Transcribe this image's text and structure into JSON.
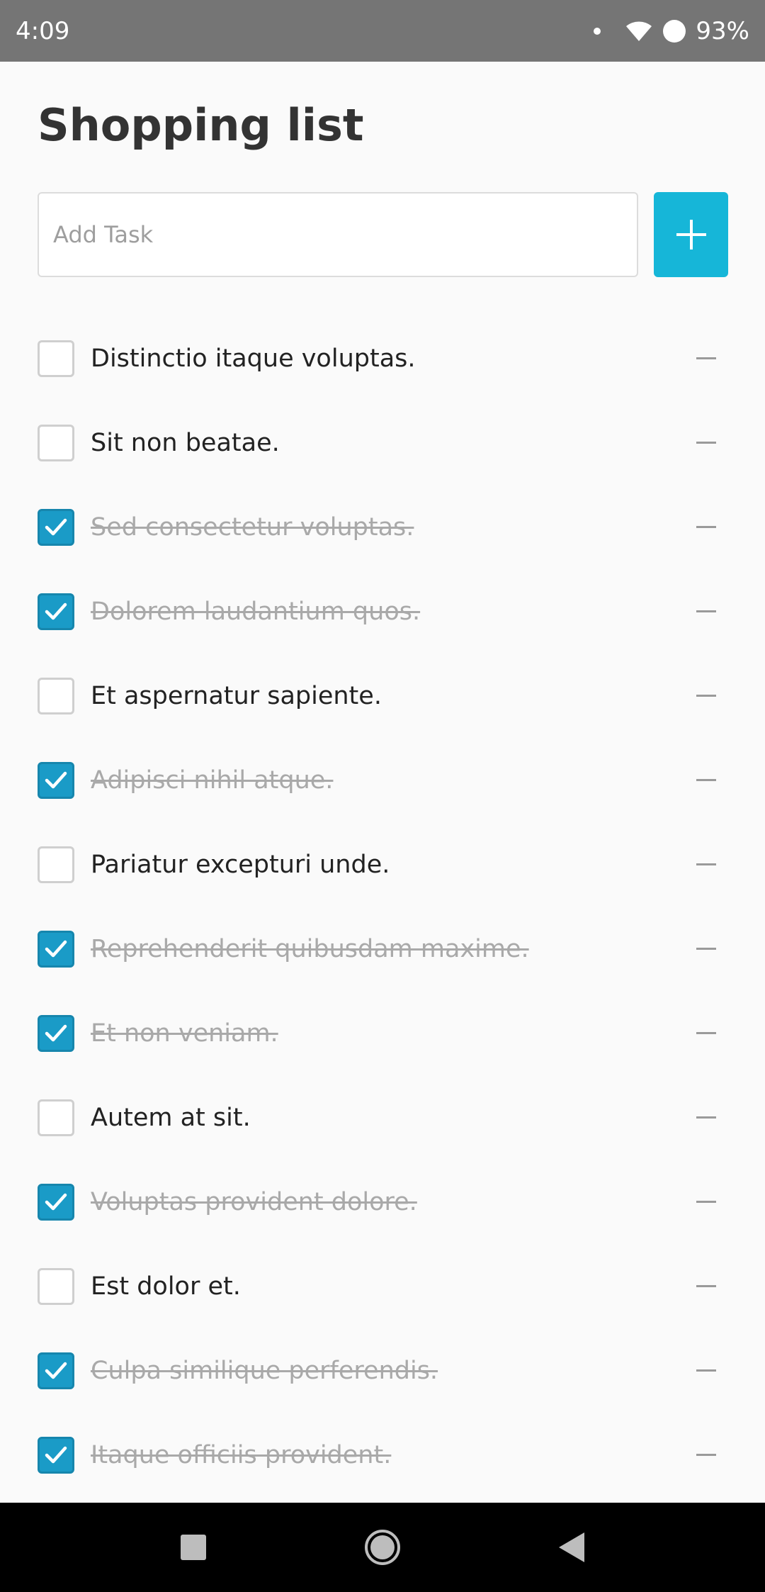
{
  "status_bar": {
    "time": "4:09",
    "battery": "93%"
  },
  "page": {
    "title": "Shopping list"
  },
  "add_task": {
    "placeholder": "Add Task",
    "value": "",
    "button_icon": "plus-icon"
  },
  "tasks": [
    {
      "label": "Distinctio itaque voluptas.",
      "checked": false
    },
    {
      "label": "Sit non beatae.",
      "checked": false
    },
    {
      "label": "Sed consectetur voluptas.",
      "checked": true
    },
    {
      "label": "Dolorem laudantium quos.",
      "checked": true
    },
    {
      "label": "Et aspernatur sapiente.",
      "checked": false
    },
    {
      "label": "Adipisci nihil atque.",
      "checked": true
    },
    {
      "label": "Pariatur excepturi unde.",
      "checked": false
    },
    {
      "label": "Reprehenderit quibusdam maxime.",
      "checked": true
    },
    {
      "label": "Et non veniam.",
      "checked": true
    },
    {
      "label": "Autem at sit.",
      "checked": false
    },
    {
      "label": "Voluptas provident dolore.",
      "checked": true
    },
    {
      "label": "Est dolor et.",
      "checked": false
    },
    {
      "label": "Culpa similique perferendis.",
      "checked": true
    },
    {
      "label": "Itaque officiis provident.",
      "checked": true
    }
  ],
  "colors": {
    "accent": "#16b6d8",
    "checked": "#1a9bc7",
    "status_bar": "#757575",
    "nav_bar": "#000000"
  },
  "nav_bar": {
    "icons": [
      "recents-square-icon",
      "home-circle-icon",
      "back-triangle-icon"
    ]
  }
}
